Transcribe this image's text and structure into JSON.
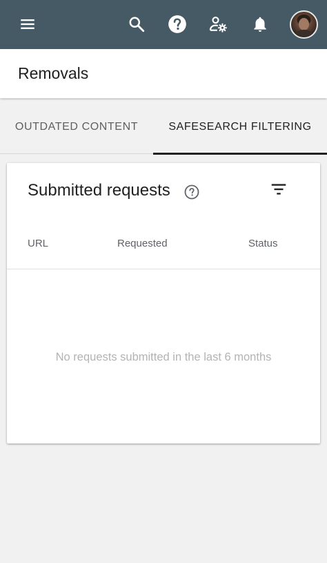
{
  "header": {
    "title": "Removals"
  },
  "topbar": {
    "icons": [
      "menu-icon",
      "search-icon",
      "help-icon",
      "manage-users-icon",
      "notifications-icon"
    ],
    "color": "#455a64"
  },
  "tabs": [
    {
      "label": "OUTDATED CONTENT",
      "active": false
    },
    {
      "label": "SAFESEARCH FILTERING",
      "active": true
    }
  ],
  "card": {
    "title": "Submitted requests",
    "columns": [
      "URL",
      "Requested",
      "Status"
    ],
    "empty_message": "No requests submitted in the last 6 months"
  }
}
